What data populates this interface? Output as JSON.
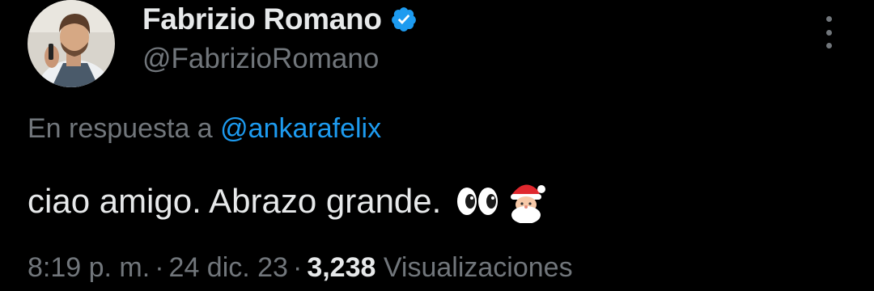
{
  "author": {
    "display_name": "Fabrizio Romano",
    "handle": "@FabrizioRomano",
    "verified_icon": "verified-badge-icon",
    "avatar_icon": "profile-photo"
  },
  "reply": {
    "prefix": "En respuesta a",
    "mention": "@ankarafelix"
  },
  "tweet": {
    "text": "ciao amigo. Abrazo grande.",
    "emojis": [
      "eyes-emoji",
      "santa-emoji"
    ]
  },
  "meta": {
    "time": "8:19 p. m.",
    "separator": "·",
    "date": "24 dic. 23",
    "views_count": "3,238",
    "views_label": "Visualizaciones"
  },
  "colors": {
    "background": "#000000",
    "text_primary": "#e7e9ea",
    "text_secondary": "#71767b",
    "accent": "#1d9bf0"
  }
}
